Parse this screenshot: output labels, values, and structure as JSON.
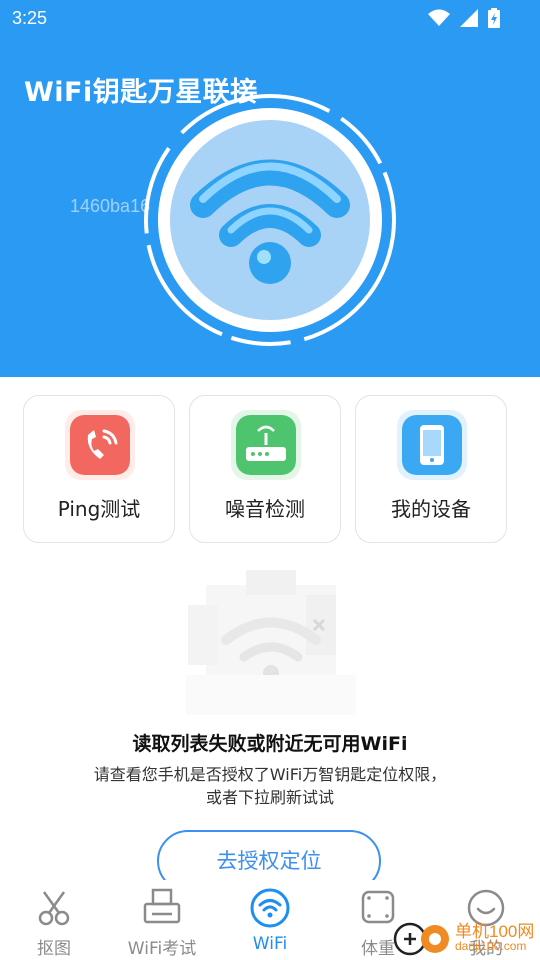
{
  "status_bar": {
    "time": "3:25"
  },
  "header": {
    "title": "WiFi钥匙万星联接",
    "device_id": "1460ba16"
  },
  "tools": [
    {
      "label": "Ping测试",
      "icon": "ping-icon",
      "color": "#f2675f"
    },
    {
      "label": "噪音检测",
      "icon": "router-icon",
      "color": "#4fc46e"
    },
    {
      "label": "我的设备",
      "icon": "phone-icon",
      "color": "#3aa8f3"
    }
  ],
  "empty_state": {
    "title": "读取列表失败或附近无可用WiFi",
    "desc_line1": "请查看您手机是否授权了WiFi万智钥匙定位权限，",
    "desc_line2": "或者下拉刷新试试",
    "button": "去授权定位"
  },
  "bottom_nav": [
    {
      "label": "抠图",
      "icon": "scissors-icon",
      "active": false
    },
    {
      "label": "WiFi考试",
      "icon": "printer-icon",
      "active": false
    },
    {
      "label": "WiFi",
      "icon": "wifi-icon",
      "active": true
    },
    {
      "label": "体重",
      "icon": "scale-icon",
      "active": false
    },
    {
      "label": "我的",
      "icon": "smile-icon",
      "active": false
    }
  ],
  "watermark": {
    "text": "单机100网",
    "sub": "danji100.com"
  },
  "colors": {
    "primary": "#2b9af3",
    "accent": "#3d8ff0"
  }
}
